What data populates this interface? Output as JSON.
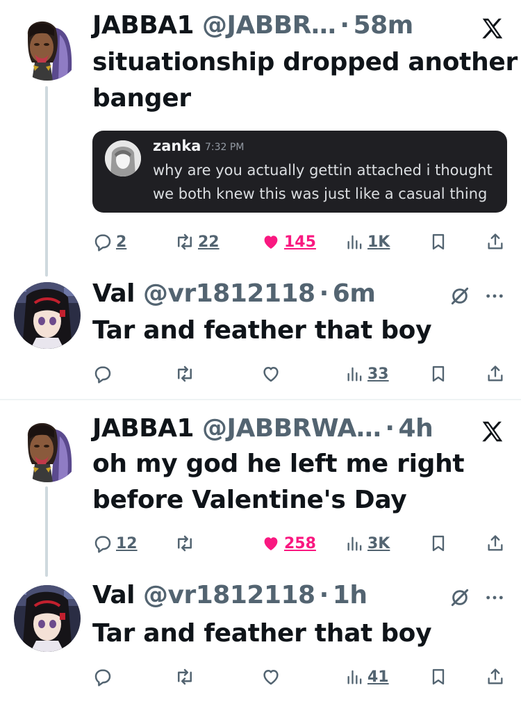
{
  "threads": [
    {
      "parent": {
        "author_name": "JABBA1",
        "author_handle": "@JABBR…",
        "separator": "·",
        "time": "58m",
        "text_lines": [
          "situationship dropped another",
          "banger"
        ],
        "embed": {
          "author": "zanka",
          "time": "7:32 PM",
          "text": "why are you actually gettin attached i thought we both knew this was just like a casual thing"
        },
        "actions": {
          "replies": "2",
          "reposts": "22",
          "likes": "145",
          "views": "1K"
        }
      },
      "reply": {
        "author_name": "Val",
        "author_handle": "@vr1812118",
        "separator": "·",
        "time": "6m",
        "text": "Tar and feather that boy",
        "actions": {
          "replies": "",
          "reposts": "",
          "likes": "",
          "views": "33"
        }
      }
    },
    {
      "parent": {
        "author_name": "JABBA1",
        "author_handle": "@JABBRWA…",
        "separator": "·",
        "time": "4h",
        "text_lines": [
          "oh my god he left me right",
          "before Valentine's Day"
        ],
        "actions": {
          "replies": "12",
          "reposts": "",
          "likes": "258",
          "views": "3K"
        }
      },
      "reply": {
        "author_name": "Val",
        "author_handle": "@vr1812118",
        "separator": "·",
        "time": "1h",
        "text": "Tar and feather that boy",
        "actions": {
          "replies": "",
          "reposts": "",
          "likes": "",
          "views": "41"
        }
      }
    }
  ],
  "colors": {
    "text": "#0f1419",
    "muted": "#536471",
    "like": "#f91880",
    "thread_line": "#cfd9de",
    "embed_bg": "#1f1f23"
  },
  "icons": [
    "reply-icon",
    "repost-icon",
    "like-icon",
    "liked-heart-icon",
    "views-icon",
    "bookmark-icon",
    "share-icon",
    "x-logo-icon",
    "grok-icon",
    "more-icon"
  ]
}
